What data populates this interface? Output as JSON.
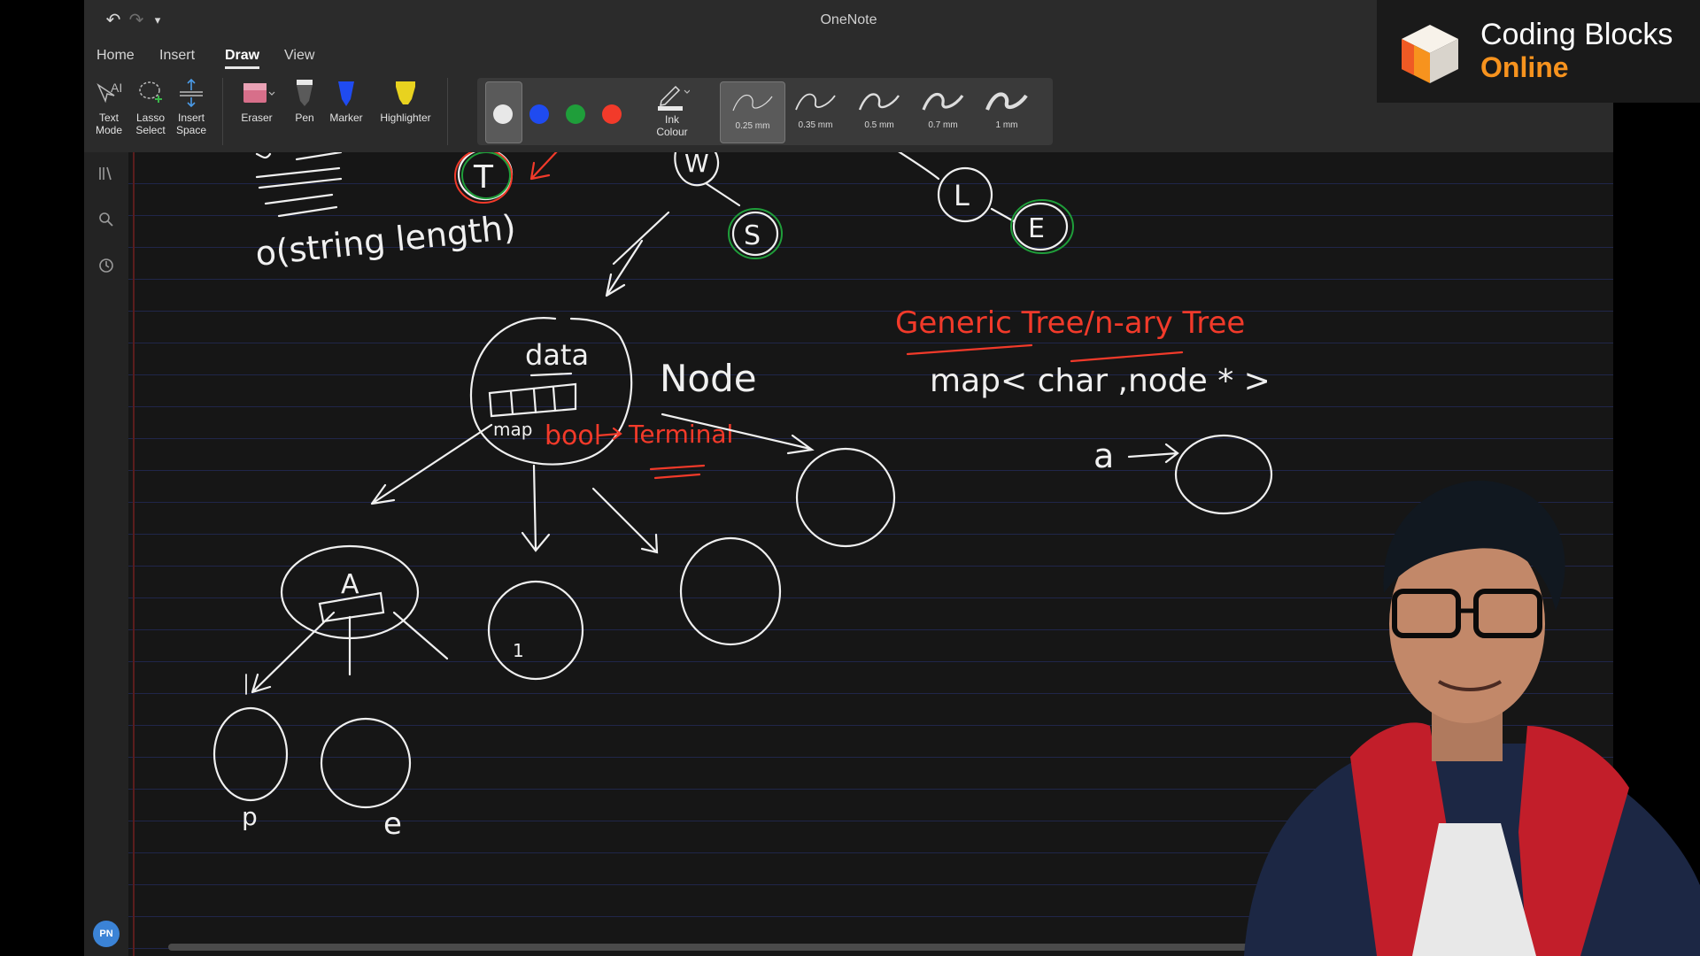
{
  "window": {
    "title": "OneNote"
  },
  "toolbar": {
    "undo_icon": "undo-icon",
    "redo_icon": "redo-icon",
    "more_icon": "customize-icon"
  },
  "tabs": [
    {
      "label": "Home"
    },
    {
      "label": "Insert"
    },
    {
      "label": "Draw",
      "active": true
    },
    {
      "label": "View"
    }
  ],
  "ribbon": {
    "text_mode": [
      "Text",
      "Mode"
    ],
    "lasso_select": [
      "Lasso",
      "Select"
    ],
    "insert_space": [
      "Insert",
      "Space"
    ],
    "eraser": "Eraser",
    "pen": "Pen",
    "marker": "Marker",
    "highlighter": "Highlighter",
    "ink_colour": [
      "Ink",
      "Colour"
    ],
    "colors": [
      "#e8e8e8",
      "#1f4bf0",
      "#1f9e3a",
      "#f23a2a"
    ],
    "thickness": [
      "0.25 mm",
      "0.35 mm",
      "0.5 mm",
      "0.7 mm",
      "1 mm"
    ],
    "selected_thickness": "0.25 mm"
  },
  "sidebar": {
    "icons": [
      "notebooks-icon",
      "search-icon",
      "recent-icon"
    ],
    "avatar": "PN"
  },
  "notes": {
    "string_length": "o(string length)",
    "data": "data",
    "node": "Node",
    "map_label": "map",
    "bool": "bool",
    "terminal": "Terminal",
    "generic_tree": "Generic Tree/n-ary Tree",
    "map_decl": "map< char ,node * >",
    "a_arrow": "a",
    "letters": {
      "T": "T",
      "W": "W",
      "S": "S",
      "L": "L",
      "E": "E",
      "A": "A",
      "p": "p",
      "e": "e",
      "one": "1"
    }
  },
  "brand": {
    "line1": "Coding Blocks",
    "line2": "Online",
    "accent": "#f7931e"
  }
}
